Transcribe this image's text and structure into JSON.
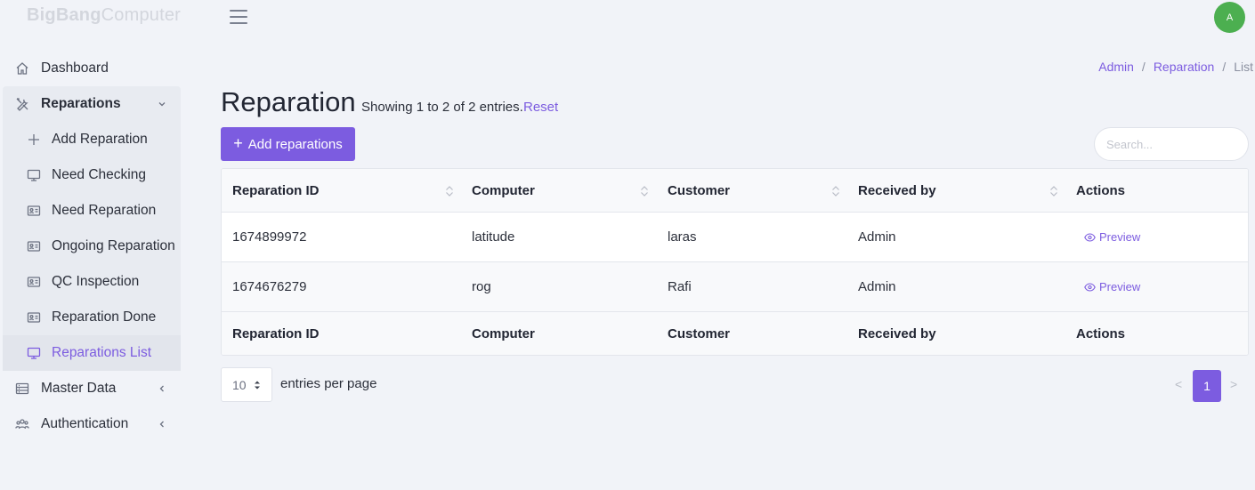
{
  "app": {
    "logo_bold": "BigBang",
    "logo_rest": "Computer",
    "avatar_initial": "A"
  },
  "sidebar": {
    "dashboard": "Dashboard",
    "reparations": "Reparations",
    "sub_items": [
      {
        "label": "Add Reparation",
        "icon": "plus-icon"
      },
      {
        "label": "Need Checking",
        "icon": "monitor-icon"
      },
      {
        "label": "Need Reparation",
        "icon": "id-card-icon"
      },
      {
        "label": "Ongoing Reparation",
        "icon": "id-card-icon"
      },
      {
        "label": "QC Inspection",
        "icon": "id-card-icon"
      },
      {
        "label": "Reparation Done",
        "icon": "id-card-icon"
      },
      {
        "label": "Reparations List",
        "icon": "monitor-icon",
        "active": true
      }
    ],
    "master_data": "Master Data",
    "authentication": "Authentication"
  },
  "breadcrumb": {
    "items": [
      "Admin",
      "Reparation",
      "List"
    ],
    "separator": "/"
  },
  "header": {
    "title": "Reparation",
    "showing": "Showing 1 to 2 of 2 entries.",
    "reset": "Reset"
  },
  "toolbar": {
    "add_label": "Add reparations",
    "search_placeholder": "Search..."
  },
  "table": {
    "columns": [
      "Reparation ID",
      "Computer",
      "Customer",
      "Received by",
      "Actions"
    ],
    "rows": [
      {
        "id": "1674899972",
        "computer": "latitude",
        "customer": "laras",
        "received_by": "Admin",
        "action": "Preview"
      },
      {
        "id": "1674676279",
        "computer": "rog",
        "customer": "Rafi",
        "received_by": "Admin",
        "action": "Preview"
      }
    ]
  },
  "pagination": {
    "per_page": "10",
    "per_page_label": "entries per page",
    "prev": "<",
    "current": "1",
    "next": ">"
  },
  "colors": {
    "accent": "#7c5ce0",
    "avatar": "#4caf50",
    "background": "#f1f3f8"
  }
}
